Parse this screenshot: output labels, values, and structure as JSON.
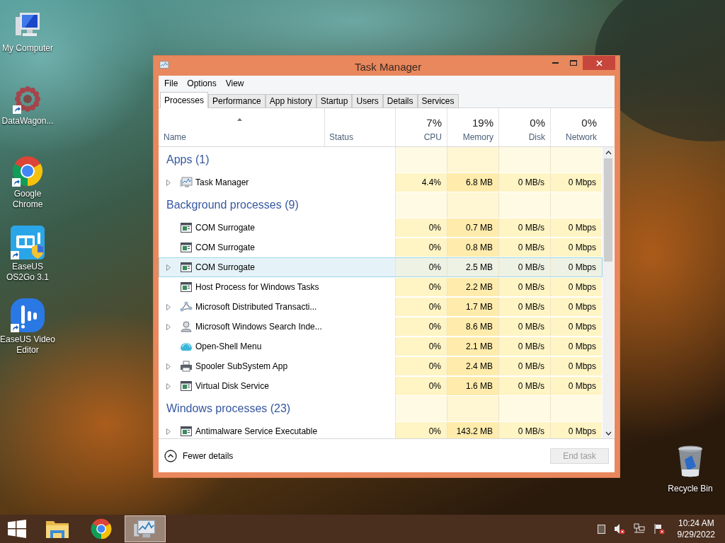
{
  "desktop_icons": [
    {
      "label": "My Computer",
      "kind": "computer",
      "shortcut": false
    },
    {
      "label": "DataWagon...",
      "kind": "burst",
      "shortcut": true
    },
    {
      "label": "Google Chrome",
      "kind": "chrome",
      "shortcut": true
    },
    {
      "label": "EaseUS OS2Go 3.1",
      "kind": "os2go",
      "shortcut": true
    },
    {
      "label": "EaseUS Video Editor",
      "kind": "video",
      "shortcut": true
    }
  ],
  "recycle_bin": {
    "label": "Recycle Bin"
  },
  "window": {
    "title": "Task Manager",
    "menu": [
      "File",
      "Options",
      "View"
    ],
    "tabs": [
      {
        "label": "Processes",
        "selected": true
      },
      {
        "label": "Performance",
        "selected": false
      },
      {
        "label": "App history",
        "selected": false
      },
      {
        "label": "Startup",
        "selected": false
      },
      {
        "label": "Users",
        "selected": false
      },
      {
        "label": "Details",
        "selected": false
      },
      {
        "label": "Services",
        "selected": false
      }
    ],
    "columns": [
      {
        "kind": "name",
        "label": "Name"
      },
      {
        "kind": "status",
        "label": "Status"
      },
      {
        "kind": "metric",
        "usage": "7%",
        "label": "CPU"
      },
      {
        "kind": "metric",
        "usage": "19%",
        "label": "Memory"
      },
      {
        "kind": "metric",
        "usage": "0%",
        "label": "Disk"
      },
      {
        "kind": "metric",
        "usage": "0%",
        "label": "Network"
      }
    ],
    "rows": [
      {
        "kind": "group",
        "label": "Apps (1)"
      },
      {
        "kind": "monitor",
        "name": "Task Manager",
        "expandable": true,
        "selected": false,
        "cells": [
          "4.4%",
          "6.8 MB",
          "0 MB/s",
          "0 Mbps"
        ]
      },
      {
        "kind": "group",
        "label": "Background processes (9)"
      },
      {
        "kind": "window",
        "name": "COM Surrogate",
        "expandable": false,
        "selected": false,
        "cells": [
          "0%",
          "0.7 MB",
          "0 MB/s",
          "0 Mbps"
        ]
      },
      {
        "kind": "window",
        "name": "COM Surrogate",
        "expandable": false,
        "selected": false,
        "cells": [
          "0%",
          "0.8 MB",
          "0 MB/s",
          "0 Mbps"
        ]
      },
      {
        "kind": "window",
        "name": "COM Surrogate",
        "expandable": true,
        "selected": true,
        "cells": [
          "0%",
          "2.5 MB",
          "0 MB/s",
          "0 Mbps"
        ]
      },
      {
        "kind": "window",
        "name": "Host Process for Windows Tasks",
        "expandable": false,
        "selected": false,
        "cells": [
          "0%",
          "2.2 MB",
          "0 MB/s",
          "0 Mbps"
        ]
      },
      {
        "kind": "network",
        "name": "Microsoft Distributed Transacti...",
        "expandable": true,
        "selected": false,
        "cells": [
          "0%",
          "1.7 MB",
          "0 MB/s",
          "0 Mbps"
        ]
      },
      {
        "kind": "user",
        "name": "Microsoft Windows Search Inde...",
        "expandable": true,
        "selected": false,
        "cells": [
          "0%",
          "8.6 MB",
          "0 MB/s",
          "0 Mbps"
        ]
      },
      {
        "kind": "shell",
        "name": "Open-Shell Menu",
        "expandable": false,
        "selected": false,
        "cells": [
          "0%",
          "2.1 MB",
          "0 MB/s",
          "0 Mbps"
        ]
      },
      {
        "kind": "printer",
        "name": "Spooler SubSystem App",
        "expandable": true,
        "selected": false,
        "cells": [
          "0%",
          "2.4 MB",
          "0 MB/s",
          "0 Mbps"
        ]
      },
      {
        "kind": "window",
        "name": "Virtual Disk Service",
        "expandable": true,
        "selected": false,
        "cells": [
          "0%",
          "1.6 MB",
          "0 MB/s",
          "0 Mbps"
        ]
      },
      {
        "kind": "group",
        "label": "Windows processes (23)"
      },
      {
        "kind": "window",
        "name": "Antimalware Service Executable",
        "expandable": true,
        "selected": false,
        "cells": [
          "0%",
          "143.2 MB",
          "0 MB/s",
          "0 Mbps"
        ]
      }
    ],
    "footer": {
      "toggle": "Fewer details",
      "end_task": {
        "label": "End task",
        "disabled": true
      }
    }
  },
  "taskbar": {
    "apps": [
      {
        "kind": "explorer",
        "active": false
      },
      {
        "kind": "chrome",
        "active": false
      },
      {
        "kind": "taskmgr",
        "active": true
      }
    ],
    "clock": {
      "time": "10:24 AM",
      "date": "9/29/2022"
    }
  }
}
